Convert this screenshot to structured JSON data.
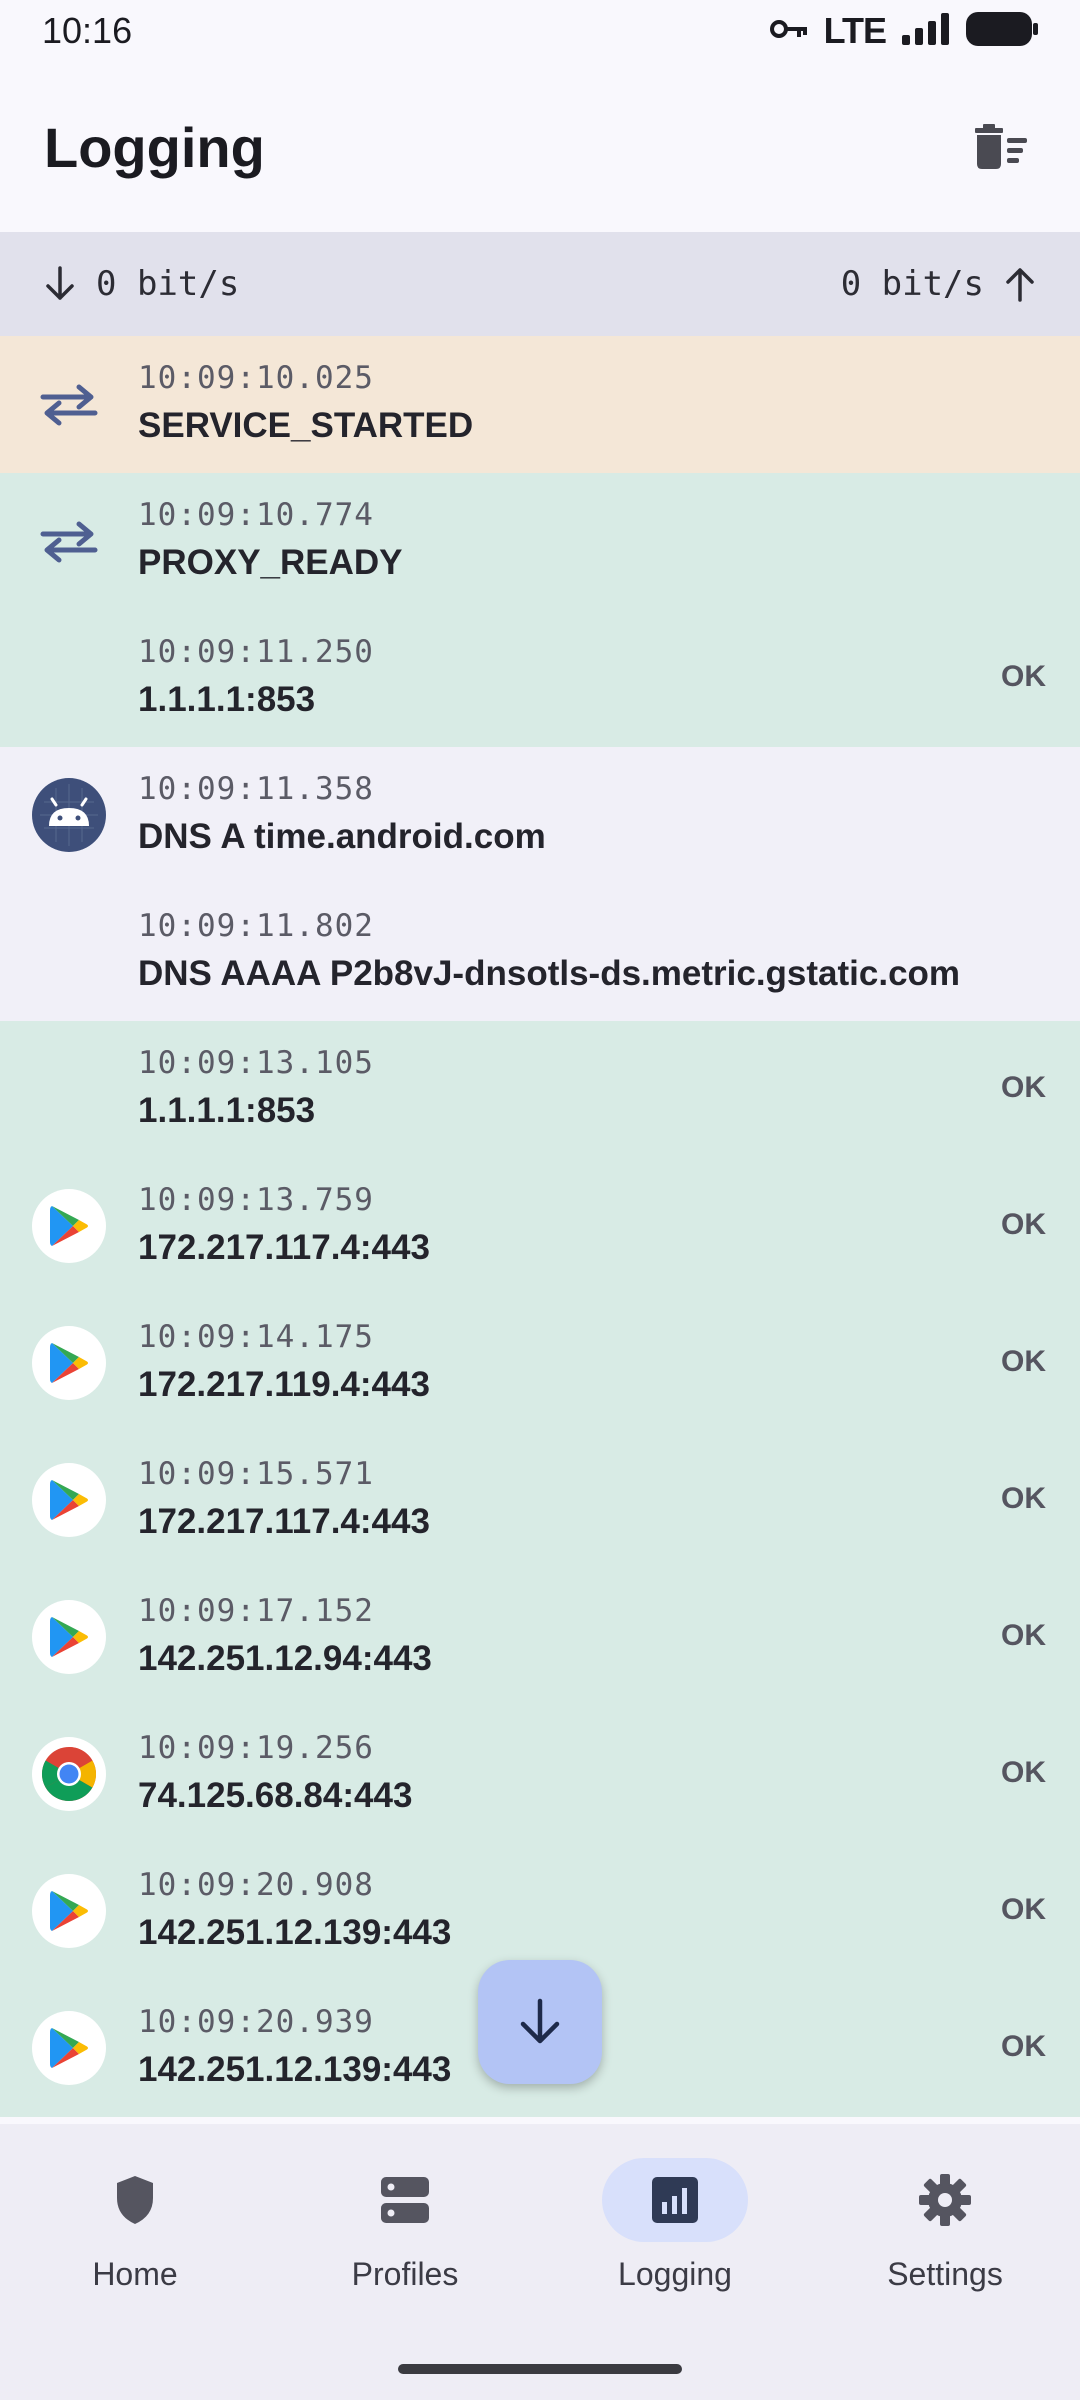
{
  "status_bar": {
    "time": "10:16",
    "network": "LTE"
  },
  "app_bar": {
    "title": "Logging"
  },
  "speed": {
    "down": "0 bit/s",
    "up": "0 bit/s"
  },
  "log": [
    {
      "time": "10:09:10.025",
      "message": "SERVICE_STARTED",
      "status": "",
      "icon": "swap-arrows-icon",
      "bg": "#f4e7d7"
    },
    {
      "time": "10:09:10.774",
      "message": "PROXY_READY",
      "status": "",
      "icon": "swap-arrows-icon",
      "bg": "#d8ebe5"
    },
    {
      "time": "10:09:11.250",
      "message": "1.1.1.1:853",
      "status": "OK",
      "icon": "",
      "bg": "#d8ebe5"
    },
    {
      "time": "10:09:11.358",
      "message": "DNS A time.android.com",
      "status": "",
      "icon": "android-icon",
      "bg": "#f1f0f8"
    },
    {
      "time": "10:09:11.802",
      "message": "DNS AAAA P2b8vJ-dnsotls-ds.metric.gstatic.com",
      "status": "",
      "icon": "",
      "bg": "#f1f0f8"
    },
    {
      "time": "10:09:13.105",
      "message": "1.1.1.1:853",
      "status": "OK",
      "icon": "",
      "bg": "#d8ebe5"
    },
    {
      "time": "10:09:13.759",
      "message": "172.217.117.4:443",
      "status": "OK",
      "icon": "google-play-icon",
      "bg": "#d8ebe5"
    },
    {
      "time": "10:09:14.175",
      "message": "172.217.119.4:443",
      "status": "OK",
      "icon": "google-play-icon",
      "bg": "#d8ebe5"
    },
    {
      "time": "10:09:15.571",
      "message": "172.217.117.4:443",
      "status": "OK",
      "icon": "google-play-icon",
      "bg": "#d8ebe5"
    },
    {
      "time": "10:09:17.152",
      "message": "142.251.12.94:443",
      "status": "OK",
      "icon": "google-play-icon",
      "bg": "#d8ebe5"
    },
    {
      "time": "10:09:19.256",
      "message": "74.125.68.84:443",
      "status": "OK",
      "icon": "chrome-icon",
      "bg": "#d8ebe5"
    },
    {
      "time": "10:09:20.908",
      "message": "142.251.12.139:443",
      "status": "OK",
      "icon": "google-play-icon",
      "bg": "#d8ebe5"
    },
    {
      "time": "10:09:20.939",
      "message": "142.251.12.139:443",
      "status": "OK",
      "icon": "google-play-icon",
      "bg": "#d8ebe5"
    }
  ],
  "nav": [
    {
      "label": "Home",
      "icon": "shield-icon",
      "active": false
    },
    {
      "label": "Profiles",
      "icon": "server-icon",
      "active": false
    },
    {
      "label": "Logging",
      "icon": "chart-icon",
      "active": true
    },
    {
      "label": "Settings",
      "icon": "gear-icon",
      "active": false
    }
  ],
  "colors": {
    "accent": "#b3c4f5",
    "nav_active": "#d8e0fb",
    "row_ok": "#d8ebe5",
    "row_service": "#f4e7d7",
    "row_dns": "#f1f0f8",
    "icon_blue": "#4f5f91"
  }
}
